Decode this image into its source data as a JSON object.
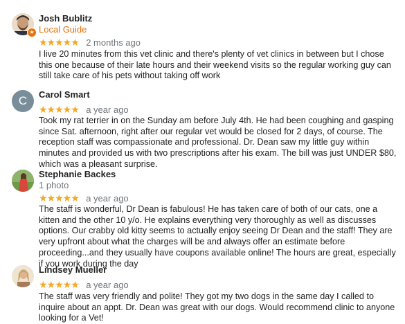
{
  "reviews": [
    {
      "name": "Josh Bublitz",
      "subtitle": "Local Guide",
      "stars": "★★★★★",
      "date": "2 months ago",
      "text": "I live 20 minutes from this vet clinic and there's plenty of vet clinics in between but I chose this one because of their late hours and their weekend visits so the regular working guy can still take care of his pets without taking off work",
      "badge_icon": "star-icon"
    },
    {
      "name": "Carol Smart",
      "initial": "C",
      "avatar_color": "#7a8d9a",
      "stars": "★★★★★",
      "date": "a year ago",
      "text": "Took my rat terrier in on the Sunday am before July 4th.  He had been coughing and gasping since Sat. afternoon, right after our regular vet would be closed for 2 days, of course.  The reception staff was compassionate and professional.  Dr. Dean saw my little guy within minutes and provided us with two prescriptions after his exam.  The bill was just UNDER $80, which was a pleasant surprise."
    },
    {
      "name": "Stephanie Backes",
      "subtitle": "1 photo",
      "stars": "★★★★★",
      "date": "a year ago",
      "text": "The staff is wonderful, Dr Dean is fabulous!  He has taken care of both of our cats, one a kitten and the other 10 y/o.  He explains everything very thoroughly as well as discusses options.  Our crabby old kitty seems to actually enjoy seeing Dr Dean and the staff!  They are very upfront about what the charges will be and always offer an estimate before proceeding...and they usually have coupons available online! The hours are great, especially if you work during the day"
    },
    {
      "name": "Lindsey Mueller",
      "stars": "★★★★★",
      "date": "a year ago",
      "text": "The staff was very friendly and polite! They got my two dogs in the same day I called to inquire about an appt. Dr. Dean was great with our dogs. Would recommend clinic to anyone looking for a Vet!"
    }
  ],
  "colors": {
    "star": "#f5a623",
    "local_guide": "#e8710a",
    "muted": "#70757a"
  }
}
